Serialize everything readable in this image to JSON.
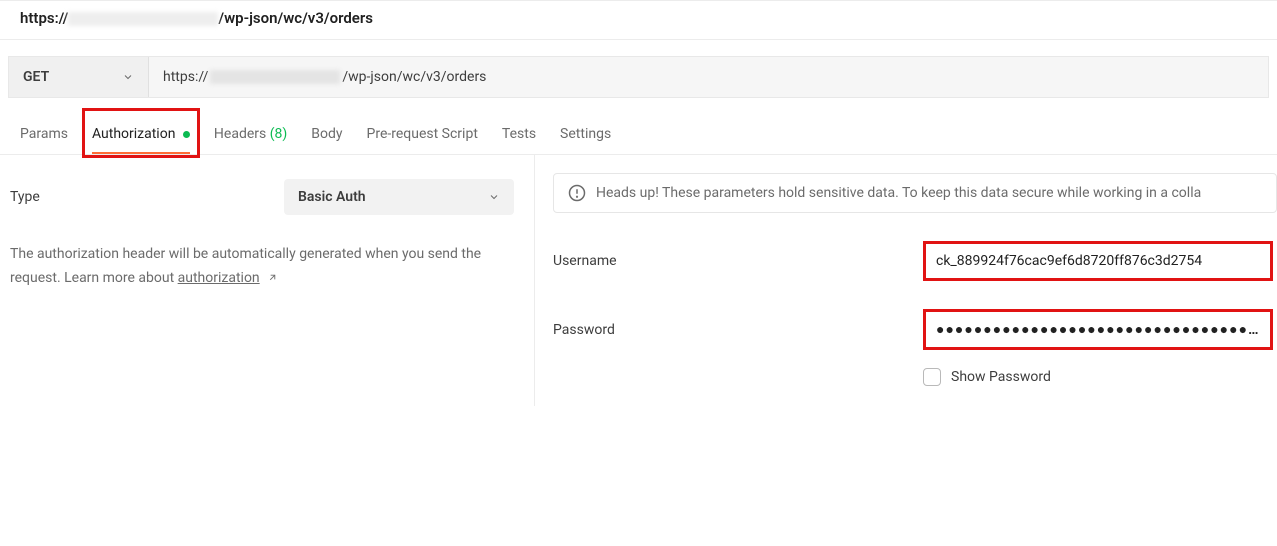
{
  "header": {
    "url_prefix": "https://",
    "url_suffix": "/wp-json/wc/v3/orders"
  },
  "request": {
    "method": "GET",
    "url_prefix": "https://",
    "url_suffix": "/wp-json/wc/v3/orders"
  },
  "tabs": {
    "params": "Params",
    "authorization": "Authorization",
    "headers": "Headers",
    "headers_count": "(8)",
    "body": "Body",
    "pre_request": "Pre-request Script",
    "tests": "Tests",
    "settings": "Settings"
  },
  "left": {
    "type_label": "Type",
    "type_value": "Basic Auth",
    "help_text_1": "The authorization header will be automatically generated when you send the request. Learn more about ",
    "help_link": "authorization"
  },
  "right": {
    "alert": "Heads up! These parameters hold sensitive data. To keep this data secure while working in a colla",
    "username_label": "Username",
    "username_value": "ck_889924f76cac9ef6d8720ff876c3d2754",
    "password_label": "Password",
    "password_value": "●●●●●●●●●●●●●●●●●●●●●●●●●●●●●●●●●●●●●",
    "show_password": "Show Password"
  }
}
